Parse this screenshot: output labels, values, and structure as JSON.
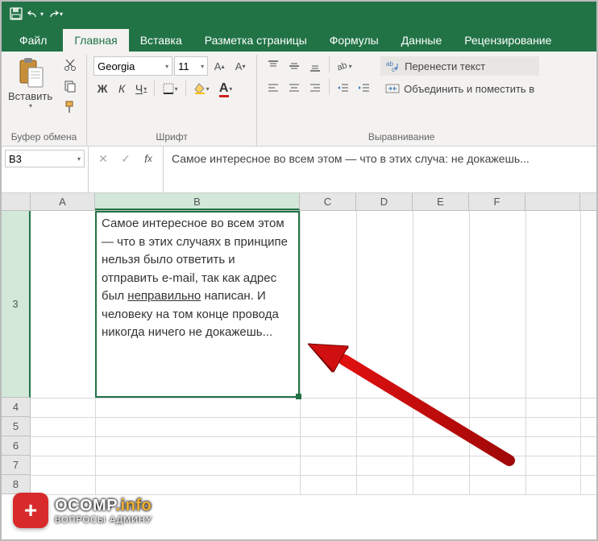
{
  "titlebar": {
    "save_icon": "save-icon",
    "undo_icon": "undo-icon",
    "redo_icon": "redo-icon"
  },
  "tabs": {
    "file": "Файл",
    "home": "Главная",
    "insert": "Вставка",
    "layout": "Разметка страницы",
    "formulas": "Формулы",
    "data": "Данные",
    "review": "Рецензирование"
  },
  "ribbon": {
    "clipboard": {
      "paste": "Вставить",
      "group_label": "Буфер обмена"
    },
    "font": {
      "name": "Georgia",
      "size": "11",
      "bold": "Ж",
      "italic": "К",
      "underline": "Ч",
      "group_label": "Шрифт"
    },
    "alignment": {
      "wrap": "Перенести текст",
      "merge": "Объединить и поместить в",
      "group_label": "Выравнивание"
    }
  },
  "namebox": "B3",
  "formula": "Самое интересное во всем этом — что в этих случаях в принципе нельзя было ответить и отправить e-mail, так как адрес был неправильно написан. И человеку на том конце провода никогда ничего не докажешь...",
  "formula_visible": "Самое интересное во всем этом — что в этих случа: не докажешь...",
  "columns": [
    "A",
    "B",
    "C",
    "D",
    "E",
    "F"
  ],
  "rows": [
    "3",
    "4",
    "5",
    "6",
    "7",
    "8"
  ],
  "cell_B3": {
    "pre": "Самое интересное во всем этом — что в этих случаях в принципе нельзя было ответить и отправить e-mail, так как адрес был ",
    "under": "неправильно",
    "post": " написан. И человеку на том конце провода никогда ничего не докажешь..."
  },
  "logo": {
    "badge": "+",
    "main1": "OCOMP",
    "main2": ".info",
    "sub": "ВОПРОСЫ АДМИНУ"
  }
}
